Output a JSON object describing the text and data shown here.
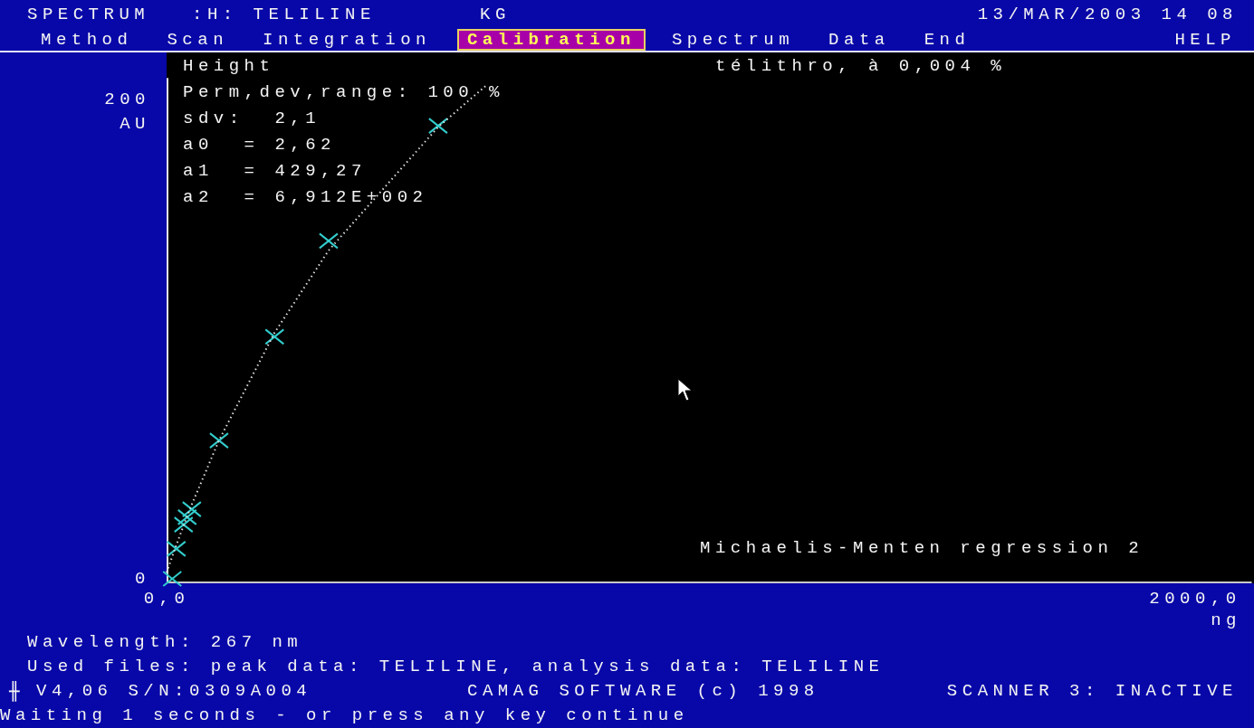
{
  "header": {
    "program": "SPECTRUM",
    "method": ":H: TELILINE",
    "plate": "KG",
    "datetime": "13/MAR/2003 14 08"
  },
  "menu": [
    {
      "label": "Method",
      "selected": false
    },
    {
      "label": "Scan",
      "selected": false
    },
    {
      "label": "Integration",
      "selected": false
    },
    {
      "label": "Calibration",
      "selected": true
    },
    {
      "label": "Spectrum",
      "selected": false
    },
    {
      "label": "Data",
      "selected": false
    },
    {
      "label": "End",
      "selected": false
    }
  ],
  "help": "HELP",
  "calibration": {
    "mode": "Height",
    "stats": [
      "Perm,dev,range: 100 %",
      "sdv:  2,1",
      "a0  = 2,62",
      "a1  = 429,27",
      "a2  = 6,912E+002"
    ],
    "substance": "télithro, à 0,004 %",
    "regression": "Michaelis-Menten regression 2",
    "chart_data": {
      "type": "scatter",
      "xlabel": "ng",
      "ylabel": "AU",
      "x": [
        0,
        11,
        19,
        33,
        40,
        49,
        102,
        210,
        315,
        528,
        620
      ],
      "xlim": [
        0,
        2110
      ],
      "ylim": [
        -1.5,
        209
      ],
      "xticks": [
        {
          "value": 0,
          "label": "0,0"
        },
        {
          "value": 2000,
          "label": "2000,0"
        }
      ],
      "yticks": [
        {
          "value": 0,
          "label": "0"
        },
        {
          "value": 200,
          "label": "200"
        }
      ],
      "series": [
        {
          "color": "#33cccc",
          "values": [
            null,
            0,
            12.5,
            22.6,
            25.7,
            29,
            57.7,
            101,
            141,
            189,
            null
          ]
        },
        {
          "type": "line",
          "line_style": "dotted",
          "color": "#e0e0e0",
          "values": [
            2.6,
            9.3,
            14.1,
            22.2,
            26.1,
            31,
            57.8,
            102.7,
            137,
            188.5,
            205.6
          ]
        }
      ]
    }
  },
  "wavelength": "Wavelength: 267 nm",
  "files": "Used files: peak data: TELILINE, analysis data: TELILINE",
  "status_bar": {
    "icon_char": "╫",
    "version": "V4,06 S/N:0309A004",
    "copyright": "CAMAG SOFTWARE (c) 1998",
    "scanner": "SCANNER 3: INACTIVE"
  },
  "message": "Waiting 1 seconds - or press any key continue"
}
